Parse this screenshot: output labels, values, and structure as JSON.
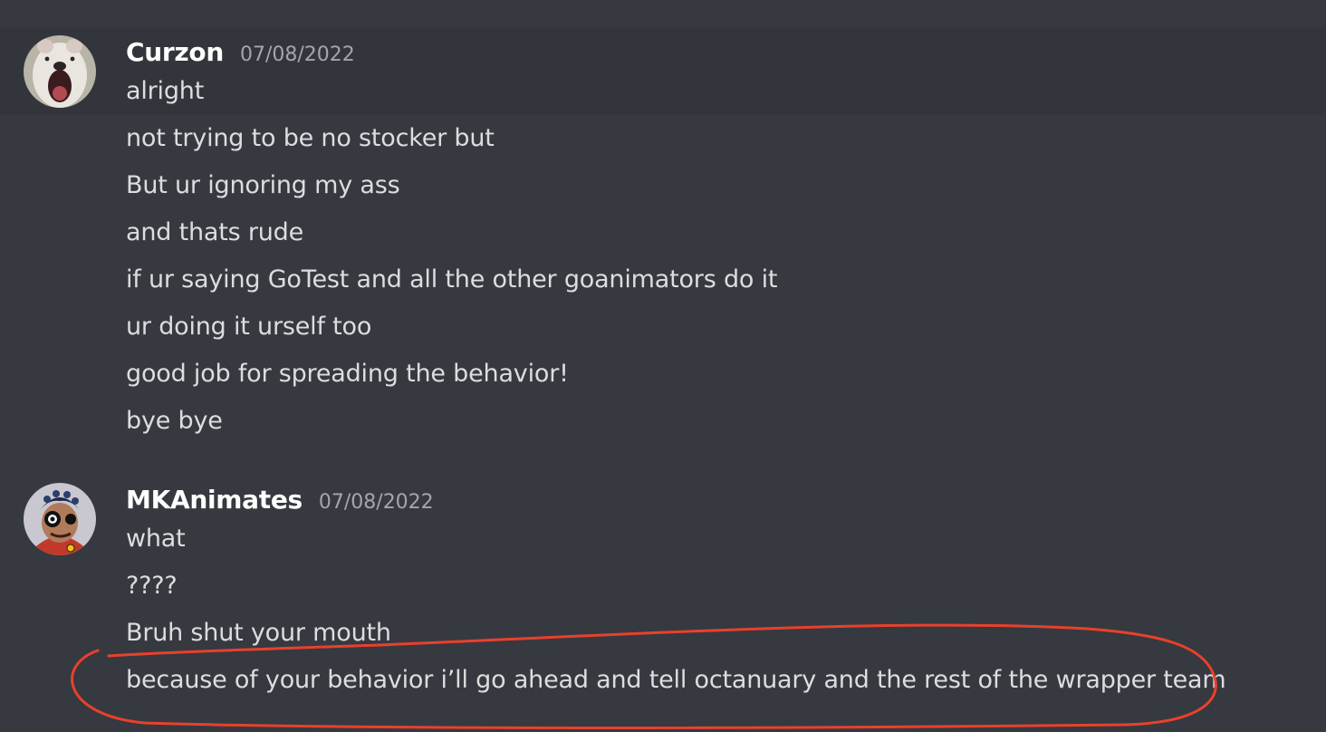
{
  "messages": [
    {
      "username": "Curzon",
      "timestamp": "07/08/2022",
      "avatar_icon": "dog-face-avatar",
      "lines": [
        "alright",
        "not trying to be no stocker but",
        "But ur ignoring my ass",
        "and thats rude",
        "if ur saying GoTest and all the other goanimators do it",
        "ur doing it urself too",
        "good job for spreading the behavior!",
        "bye bye"
      ]
    },
    {
      "username": "MKAnimates",
      "timestamp": "07/08/2022",
      "avatar_icon": "cartoon-character-avatar",
      "lines": [
        "what",
        "????",
        "Bruh shut your mouth",
        "because of your behavior i’ll go ahead and tell octanuary and the rest of the wrapper team"
      ]
    }
  ],
  "colors": {
    "background": "#36393f",
    "hover_background": "#32353b",
    "username": "#ffffff",
    "timestamp": "#a3a6aa",
    "message_text": "#dcddde",
    "annotation_stroke": "#e8412c"
  }
}
